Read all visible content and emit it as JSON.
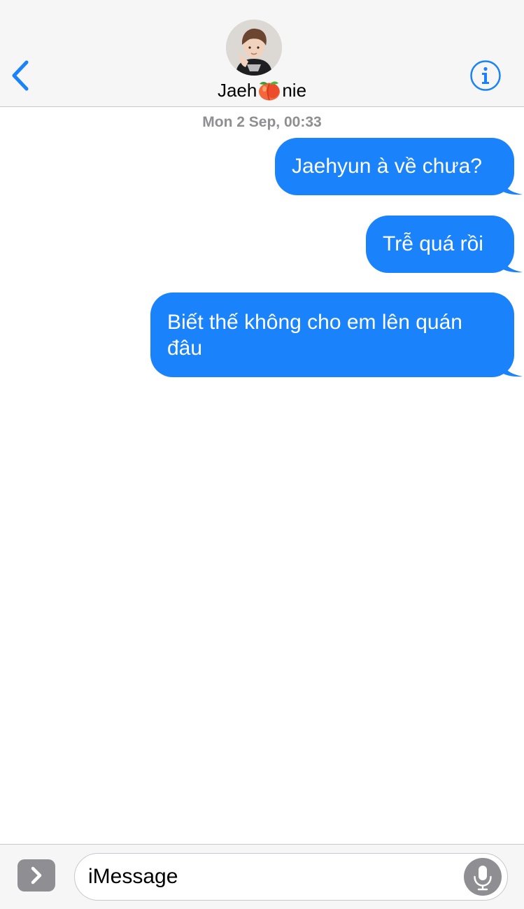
{
  "header": {
    "contact_name_prefix": "Jaeh",
    "contact_name_suffix": "nie",
    "contact_name_emoji": "peach-emoji"
  },
  "conversation": {
    "timestamp": "Mon 2 Sep, 00:33",
    "messages": [
      {
        "text": "Jaehyun à về chưa?",
        "sender": "me"
      },
      {
        "text": "Trễ quá rồi",
        "sender": "me"
      },
      {
        "text": "Biết thế không cho em lên quán đâu",
        "sender": "me"
      }
    ]
  },
  "composer": {
    "placeholder": "iMessage"
  },
  "colors": {
    "accent": "#1a82fb",
    "bubble_text": "#ffffff",
    "timestamp": "#8e8e93",
    "bar_background": "#f6f6f6"
  },
  "icons": {
    "back": "chevron-left-icon",
    "info": "info-icon",
    "apps": "chevron-right-icon",
    "mic": "microphone-icon"
  }
}
